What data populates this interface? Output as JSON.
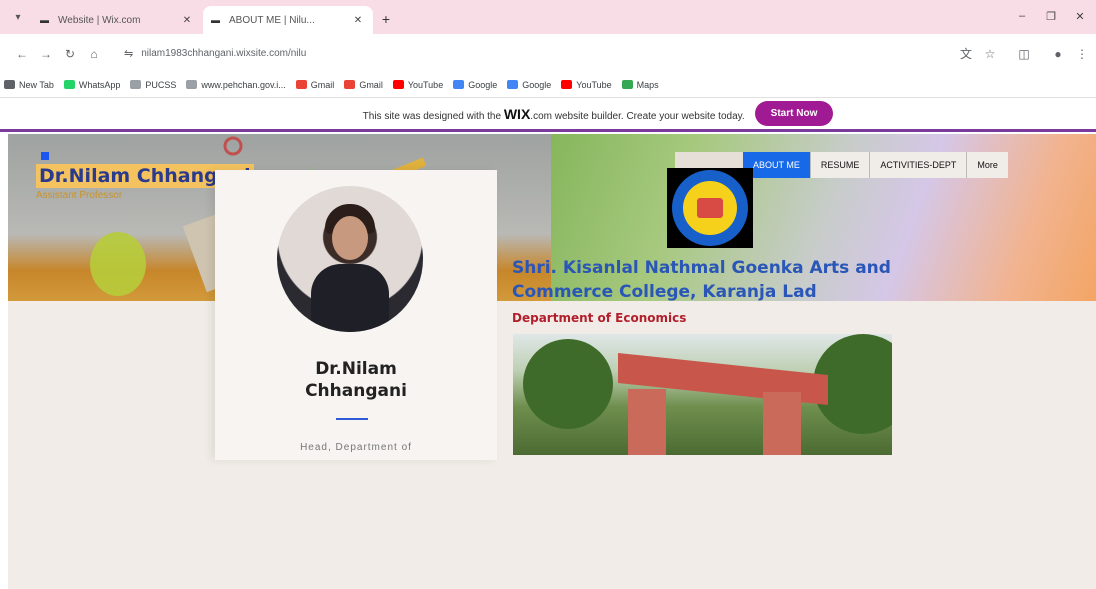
{
  "browser": {
    "tabs": [
      {
        "title": "Website | Wix.com",
        "active": false
      },
      {
        "title": "ABOUT ME | Nilu...",
        "active": true
      }
    ],
    "url": "nilam1983chhangani.wixsite.com/nilu",
    "bookmarks": [
      {
        "label": "New Tab",
        "color": "#5f6368"
      },
      {
        "label": "WhatsApp",
        "color": "#25d366"
      },
      {
        "label": "PUCSS",
        "color": "#9aa0a6"
      },
      {
        "label": "www.pehchan.gov.i...",
        "color": "#9aa0a6"
      },
      {
        "label": "Gmail",
        "color": "#ea4335"
      },
      {
        "label": "Gmail",
        "color": "#ea4335"
      },
      {
        "label": "YouTube",
        "color": "#ff0000"
      },
      {
        "label": "Google",
        "color": "#4285f4"
      },
      {
        "label": "Google",
        "color": "#4285f4"
      },
      {
        "label": "YouTube",
        "color": "#ff0000"
      },
      {
        "label": "Maps",
        "color": "#34a853"
      }
    ]
  },
  "wix_banner": {
    "message": "This site was designed with the",
    "brand": "WIX",
    "message_tail": ".com website builder. Create your website today.",
    "button": "Start Now"
  },
  "header": {
    "site_name": "Dr.Nilam Chhangani",
    "site_subtitle": "Assistant Professor",
    "nav": [
      "ABOUT ME",
      "RESUME",
      "ACTIVITIES-DEPT",
      "More"
    ],
    "active_nav": "ABOUT ME"
  },
  "profile": {
    "name_line1": "Dr.Nilam",
    "name_line2": "Chhangani",
    "description": "Head, Department of"
  },
  "college": {
    "name_line1": "Shri. Kisanlal Nathmal Goenka Arts and",
    "name_line2": "Commerce College, Karanja Lad",
    "department": "Department of Economics"
  },
  "colors": {
    "accent": "#1769e8",
    "brand_purple": "#a01a93",
    "name_blue": "#2a3a8c",
    "college_blue": "#2a56b7",
    "dept_red": "#b21f2c"
  }
}
